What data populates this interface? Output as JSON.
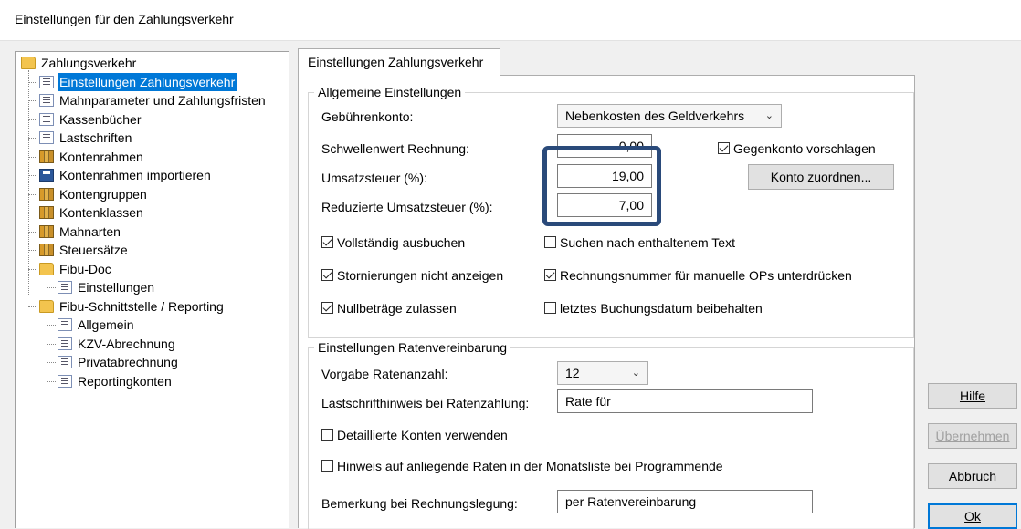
{
  "window": {
    "title": "Einstellungen für den Zahlungsverkehr"
  },
  "tree": {
    "root": "Zahlungsverkehr",
    "items": [
      {
        "label": "Einstellungen Zahlungsverkehr",
        "icon": "list-icon",
        "selected": true
      },
      {
        "label": "Mahnparameter und Zahlungsfristen",
        "icon": "list-icon"
      },
      {
        "label": "Kassenbücher",
        "icon": "list-icon"
      },
      {
        "label": "Lastschriften",
        "icon": "list-icon"
      },
      {
        "label": "Kontenrahmen",
        "icon": "books-icon"
      },
      {
        "label": "Kontenrahmen importieren",
        "icon": "save-icon"
      },
      {
        "label": "Kontengruppen",
        "icon": "books-icon"
      },
      {
        "label": "Kontenklassen",
        "icon": "books-icon"
      },
      {
        "label": "Mahnarten",
        "icon": "books-icon"
      },
      {
        "label": "Steuersätze",
        "icon": "books-icon"
      },
      {
        "label": "Fibu-Doc",
        "icon": "folder-icon"
      },
      {
        "label": "Einstellungen",
        "icon": "list-icon"
      },
      {
        "label": "Fibu-Schnittstelle / Reporting",
        "icon": "folder-icon"
      },
      {
        "label": "Allgemein",
        "icon": "list-icon"
      },
      {
        "label": "KZV-Abrechnung",
        "icon": "list-icon"
      },
      {
        "label": "Privatabrechnung",
        "icon": "list-icon"
      },
      {
        "label": "Reportingkonten",
        "icon": "list-icon"
      }
    ]
  },
  "tab": {
    "label": "Einstellungen Zahlungsverkehr"
  },
  "general": {
    "title": "Allgemeine Einstellungen",
    "fee_account_label": "Gebührenkonto:",
    "fee_account_value": "Nebenkosten des Geldverkehrs",
    "threshold_label": "Schwellenwert Rechnung:",
    "threshold_value": "0,00",
    "vat_label": "Umsatzsteuer (%):",
    "vat_value": "19,00",
    "reduced_vat_label": "Reduzierte Umsatzsteuer (%):",
    "reduced_vat_value": "7,00",
    "counter_account_label": "Gegenkonto vorschlagen",
    "assign_account_button": "Konto zuordnen...",
    "checks": [
      {
        "label": "Vollständig ausbuchen",
        "checked": true
      },
      {
        "label": "Suchen nach enthaltenem Text",
        "checked": false
      },
      {
        "label": "Stornierungen nicht anzeigen",
        "checked": true
      },
      {
        "label": "Rechnungsnummer für manuelle OPs unterdrücken",
        "checked": true
      },
      {
        "label": "Nullbeträge zulassen",
        "checked": true
      },
      {
        "label": "letztes Buchungsdatum beibehalten",
        "checked": false
      }
    ]
  },
  "installments": {
    "title": "Einstellungen Ratenvereinbarung",
    "default_count_label": "Vorgabe Ratenanzahl:",
    "default_count_value": "12",
    "debit_note_label": "Lastschrifthinweis bei Ratenzahlung:",
    "debit_note_value": "Rate für",
    "detailed_accounts_label": "Detaillierte Konten verwenden",
    "notice_label": "Hinweis auf anliegende Raten in der Monatsliste bei Programmende",
    "invoice_remark_label": "Bemerkung bei Rechnungslegung:",
    "invoice_remark_value": "per Ratenvereinbarung"
  },
  "buttons": {
    "help": "Hilfe",
    "apply": "Übernehmen",
    "cancel": "Abbruch",
    "ok": "Ok"
  },
  "colors": {
    "selection": "#0078d7",
    "highlight_frame": "#2a4a7a"
  }
}
